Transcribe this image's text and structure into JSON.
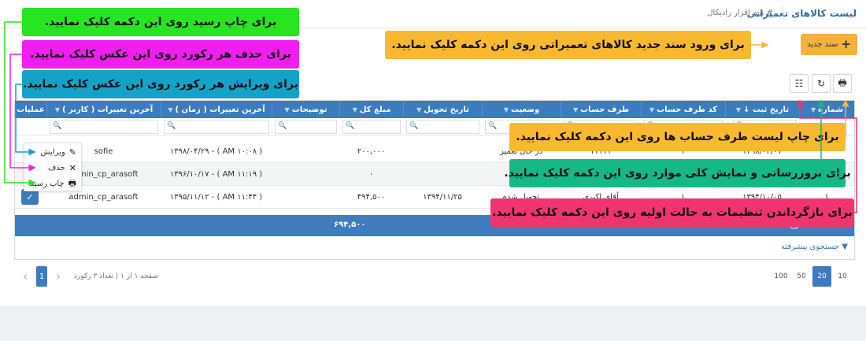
{
  "header": {
    "title": "لیست کالاهای تعمیراتی",
    "breadcrumb": "# نرم افزار رادیکال"
  },
  "toolbar": {
    "new_label": "سند جدید",
    "print_icon": "print-icon",
    "refresh_icon": "refresh-icon",
    "columns_icon": "columns-icon"
  },
  "grid": {
    "columns": [
      "شماره",
      "تاریخ ثبت ↓",
      "کد طرف حساب",
      "طرف حساب",
      "وضعیت",
      "تاریخ تحویل",
      "مبلغ کل",
      "توضیحات",
      "آخرین تغییرات ( زمان )",
      "آخرین تغییرات ( کاربر )",
      "عملیات"
    ],
    "rows": [
      [
        "",
        "۱۳۹۸/۰۲/۰۱",
        "۱",
        "۱۱۱۱۱",
        "در حال تعمیر",
        "",
        "۲۰۰,۰۰۰",
        "",
        "( AM ۱۰:۰۸ ) - ۱۳۹۸/۰۴/۲۹",
        "sofie"
      ],
      [
        "",
        "",
        "",
        "",
        "شده",
        "",
        "۰",
        "",
        "( AM ۱۱:۱۹ ) - ۱۳۹۶/۱۰/۱۷",
        "admin_cp_arasoft"
      ],
      [
        "۱",
        "۱۳۹۴/۱۰/۰۵",
        "۱",
        "آقای اکبری",
        "تحویل شده",
        "۱۳۹۴/۱۱/۲۵",
        "۴۹۴,۵۰۰",
        "",
        "( AM ۱۱:۴۴ ) - ۱۳۹۵/۱۱/۱۲",
        "admin_cp_arasoft"
      ]
    ],
    "summary_total": "۶۹۴,۵۰۰",
    "summary_label": "مجموع",
    "advanced_search": "جستجوی پیشرفته"
  },
  "row_menu": {
    "edit": "ویرایش",
    "delete": "حذف",
    "print_receipt": "چاپ رسید"
  },
  "pager": {
    "current_page": "1",
    "info": "صفحه ۱ از ۱ | تعداد ۳ رکورد",
    "page_sizes": [
      "10",
      "20",
      "50",
      "100"
    ],
    "active_size": "20"
  },
  "annotations": {
    "print_receipt": "برای چاپ رسید روی این دکمه کلیک نمایید.",
    "delete_record": "برای حذف هر رکورد روی این عکس کلیک نمایید.",
    "edit_record": "برای ویرایش هر رکورد روی این عکس کلیک نمایید.",
    "new_doc": "برای ورود سند جدید کالاهای تعمیراتی روی این دکمه کلیک نمایید.",
    "print_list": "برای چاپ لیست طرف حساب ها روی این دکمه کلیک نمایید.",
    "refresh": "برای بروزرسانی و نمایش کلی موارد روی این دکمه کلیک نمایید.",
    "reset": "برای بازگرداندن تنظیمات به حالت اولیه روی این دکمه کلیک نمایید."
  },
  "colors": {
    "primary": "#3d7bbf",
    "accent": "#f3b23d",
    "green_note": "#27e520",
    "magenta_note": "#f01ef0",
    "teal_note": "#13a3c9",
    "yellow_note": "#f8b830",
    "emerald_note": "#14b986",
    "pink_note": "#f0346f"
  }
}
